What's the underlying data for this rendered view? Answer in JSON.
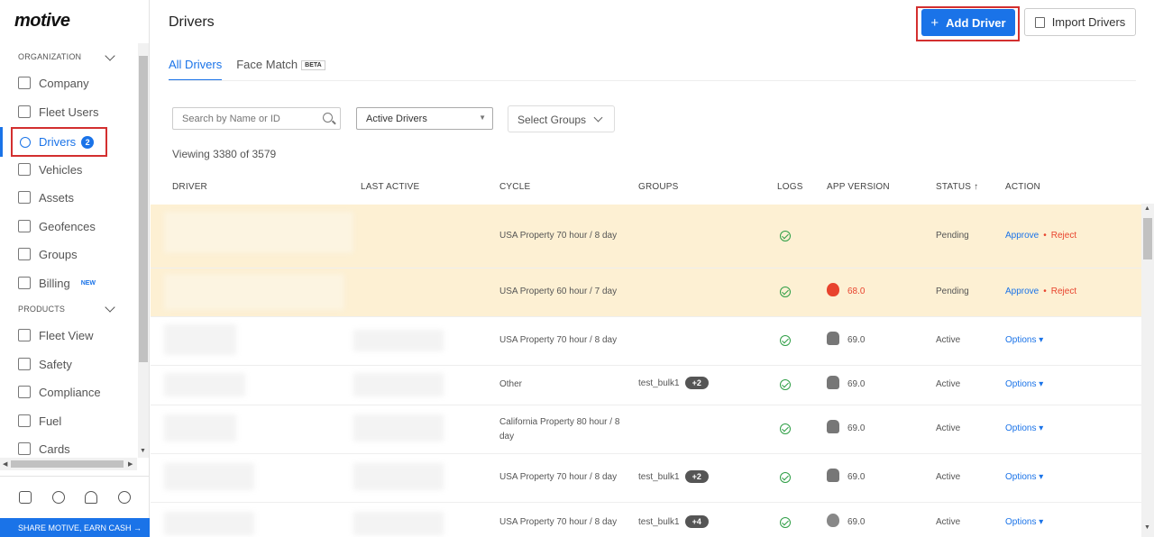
{
  "sidebar": {
    "logo": "motive",
    "org_heading": "ORGANIZATION",
    "products_heading": "PRODUCTS",
    "items": [
      {
        "label": "Company",
        "icon": "building-icon"
      },
      {
        "label": "Fleet Users",
        "icon": "monitor-icon"
      },
      {
        "label": "Drivers",
        "icon": "person-icon",
        "badge": "2",
        "active": true
      },
      {
        "label": "Vehicles",
        "icon": "truck-icon"
      },
      {
        "label": "Assets",
        "icon": "trailer-icon"
      },
      {
        "label": "Geofences",
        "icon": "geofence-icon"
      },
      {
        "label": "Groups",
        "icon": "groups-icon"
      },
      {
        "label": "Billing",
        "icon": "billing-icon",
        "tag": "NEW"
      },
      {
        "label": "Fleet View",
        "icon": "map-icon"
      },
      {
        "label": "Safety",
        "icon": "shield-icon"
      },
      {
        "label": "Compliance",
        "icon": "compliance-icon"
      },
      {
        "label": "Fuel",
        "icon": "fuel-icon"
      },
      {
        "label": "Cards",
        "icon": "card-icon"
      }
    ],
    "footer_icons": [
      "device-icon",
      "help-icon",
      "bell-icon",
      "account-icon"
    ],
    "promo": "SHARE MOTIVE, EARN CASH →"
  },
  "header": {
    "title": "Drivers",
    "add_button": "Add Driver",
    "import_button": "Import Drivers"
  },
  "tabs": [
    {
      "label": "All Drivers",
      "active": true
    },
    {
      "label": "Face Match",
      "tag": "BETA"
    }
  ],
  "filters": {
    "search_placeholder": "Search by Name or ID",
    "status_select": "Active Drivers",
    "groups_select": "Select Groups"
  },
  "viewing": "Viewing 3380 of 3579",
  "table": {
    "columns": [
      "DRIVER",
      "LAST ACTIVE",
      "CYCLE",
      "GROUPS",
      "LOGS",
      "APP VERSION",
      "STATUS ↑",
      "ACTION"
    ],
    "rows": [
      {
        "cycle": "USA Property 70 hour / 8 day",
        "groups": "",
        "extra": "",
        "os": "",
        "version": "",
        "status": "Pending",
        "action": "approve"
      },
      {
        "cycle": "USA Property 60 hour / 7 day",
        "groups": "",
        "extra": "",
        "os": "apple",
        "version": "68.0",
        "status": "Pending",
        "action": "approve"
      },
      {
        "cycle": "USA Property 70 hour / 8 day",
        "groups": "",
        "extra": "",
        "os": "android",
        "version": "69.0",
        "status": "Active",
        "action": "options"
      },
      {
        "cycle": "Other",
        "groups": "test_bulk1",
        "extra": "+2",
        "os": "android",
        "version": "69.0",
        "status": "Active",
        "action": "options"
      },
      {
        "cycle": "California Property 80 hour / 8 day",
        "groups": "",
        "extra": "",
        "os": "android",
        "version": "69.0",
        "status": "Active",
        "action": "options"
      },
      {
        "cycle": "USA Property 70 hour / 8 day",
        "groups": "test_bulk1",
        "extra": "+2",
        "os": "android",
        "version": "69.0",
        "status": "Active",
        "action": "options"
      },
      {
        "cycle": "USA Property 70 hour / 8 day",
        "groups": "test_bulk1",
        "extra": "+4",
        "os": "apple",
        "version": "69.0",
        "status": "Active",
        "action": "options"
      }
    ],
    "approve_label": "Approve",
    "reject_label": "Reject",
    "options_label": "Options ▾"
  }
}
